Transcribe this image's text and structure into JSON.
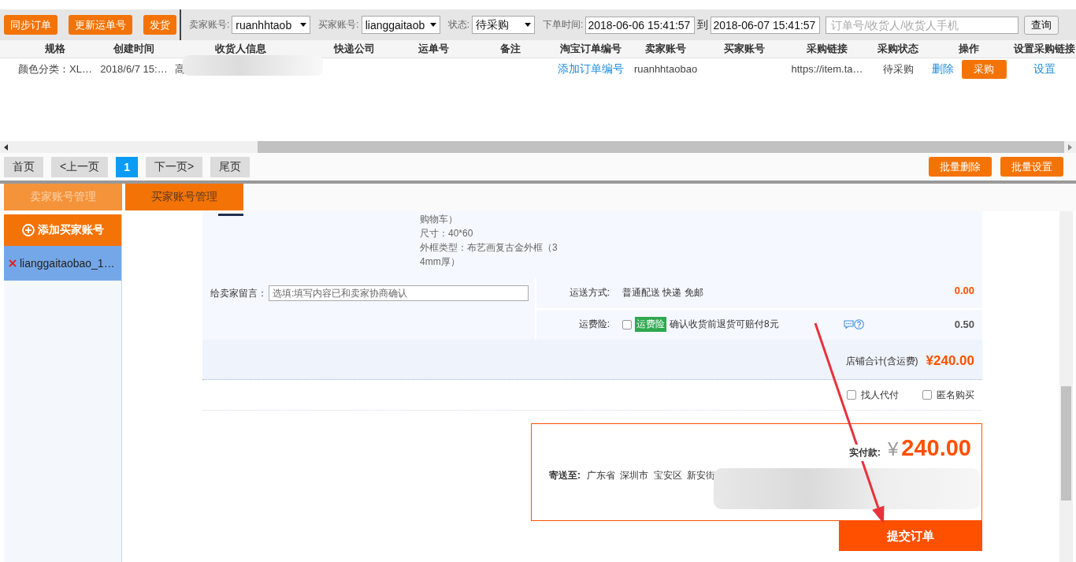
{
  "toolbar": {
    "buttons": [
      "同步订单",
      "更新运单号",
      "发货"
    ],
    "filters": [
      {
        "kind": "select",
        "label": "卖家账号:",
        "value": "ruanhhtaob"
      },
      {
        "kind": "select",
        "label": "买家账号:",
        "value": "lianggaitaob"
      },
      {
        "kind": "select",
        "label": "状态:",
        "value": "待采购"
      }
    ],
    "order_time": {
      "label": "下单时间:",
      "from": "2018-06-06 15:41:57",
      "separator": "到",
      "to": "2018-06-07 15:41:57"
    },
    "search": {
      "placeholder": "订单号/收货人/收货人手机"
    },
    "query_button": "查询"
  },
  "table": {
    "columns": [
      "规格",
      "创建时间",
      "收货人信息",
      "快递公司",
      "运单号",
      "备注",
      "淘宝订单编号",
      "卖家账号",
      "买家账号",
      "采购链接",
      "采购状态",
      "操作",
      "设置采购链接"
    ],
    "rows": [
      {
        "spec": "颜色分类：XL…",
        "created": "2018/6/7 15:…",
        "receiver": "高",
        "receiver_redacted": true,
        "taobao_order": "添加订单编号",
        "seller": "ruanhhtaobao",
        "purchase_link": "https://item.ta…",
        "purchase_status": "待采购",
        "actions": [
          {
            "kind": "link",
            "label": "删除"
          },
          {
            "kind": "button",
            "label": "采购"
          }
        ],
        "link_setting": "设置"
      }
    ]
  },
  "pagination": {
    "pages": [
      {
        "label": "首页",
        "selected": false
      },
      {
        "label": "<上一页",
        "selected": false
      },
      {
        "label": "1",
        "selected": true
      },
      {
        "label": "下一页>",
        "selected": false
      },
      {
        "label": "尾页",
        "selected": false
      }
    ],
    "batch_buttons": [
      "批量删除",
      "批量设置"
    ]
  },
  "tabs": [
    {
      "label": "卖家账号管理",
      "selected": false
    },
    {
      "label": "买家账号管理",
      "selected": true
    }
  ],
  "sidebar": {
    "add_button": "添加买家账号",
    "accounts": [
      {
        "name": "lianggaitaobao_1…",
        "selected": true
      }
    ]
  },
  "order": {
    "product_lines": [
      "购物车）",
      "尺寸：40*60",
      "外框类型：布艺画复古金外框（34mm厚）"
    ],
    "message": {
      "label": "给卖家留言：",
      "placeholder": "选填:填写内容已和卖家协商确认"
    },
    "shipping": {
      "label": "运送方式:",
      "value": "普通配送 快递 免邮",
      "price": "0.00"
    },
    "insurance": {
      "label": "运费险:",
      "checked": false,
      "badge": "运费险",
      "text": "确认收货前退货可赔付8元",
      "price": "0.50"
    },
    "store_total": {
      "label": "店铺合计(含运费)",
      "amount": "¥240.00"
    },
    "options": [
      {
        "label": "找人代付",
        "checked": false
      },
      {
        "label": "匿名购买",
        "checked": false
      }
    ],
    "payment": {
      "label": "实付款:",
      "currency": "¥",
      "amount": "240.00",
      "ship_to_label": "寄送至:",
      "address": "广东省 深圳市 宝安区 新安街",
      "address_redacted": true
    },
    "submit_button": "提交订单"
  }
}
